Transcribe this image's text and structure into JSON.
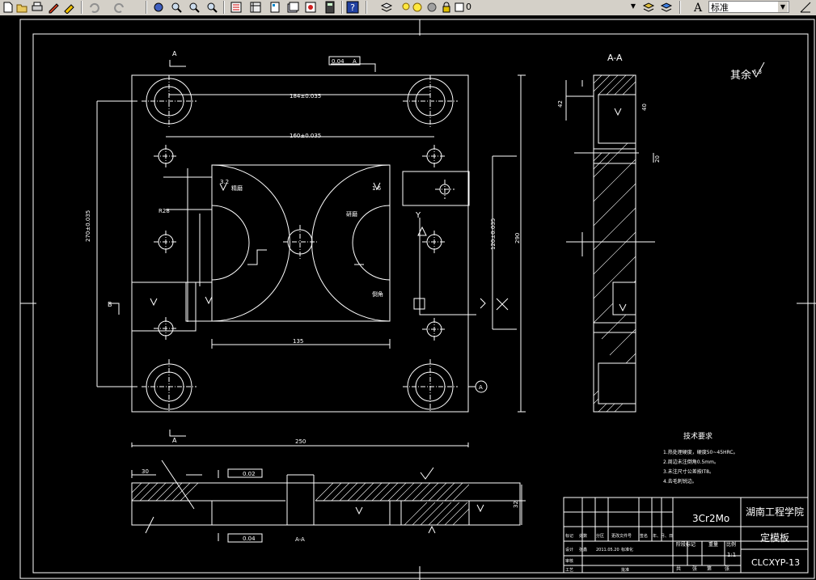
{
  "toolbar": {
    "icons": [
      "new-icon",
      "open-icon",
      "draw-icon",
      "match-properties-icon",
      "undo-icon",
      "redo-icon",
      "pan-icon",
      "zoom-realtime-icon",
      "zoom-window-icon",
      "zoom-previous-icon",
      "properties-icon",
      "design-center-icon",
      "tool-palettes-icon",
      "sheet-set-icon",
      "markup-icon",
      "calculator-icon",
      "help-icon",
      "layer-manager-icon",
      "layer-on-icon",
      "layer-freeze-icon",
      "layer-color-icon",
      "layer-lock-icon"
    ],
    "layer_value": "0",
    "textstyle_value": "标准"
  },
  "drawing": {
    "section_title": "A-A",
    "roughness_note": "其余",
    "roughness_value": "6.3",
    "tech_title": "技术要求",
    "tech_notes": [
      "1.热处理硬度，硬度50~45HRC。",
      "2.周边未注倒角0.5mm。",
      "3.未注尺寸公差按IT8。",
      "4.去毛刺锐边。"
    ],
    "material": "3Cr2Mo",
    "school": "湖南工程学院",
    "part_name": "定模板",
    "drawing_no": "CLCXYP-13",
    "scale": "1:1",
    "scale_header": "比例",
    "tb_headers": [
      "阶段标记",
      "重量"
    ],
    "tb_footer": [
      "共",
      "张",
      "第",
      "张"
    ],
    "tb_left": [
      "标记",
      "处数",
      "分区",
      "更改文件号",
      "签名",
      "年、月、日"
    ],
    "tb_left2": [
      "设计",
      "张鑫",
      "2011.05.20",
      "标准化"
    ],
    "tb_left3": [
      "审核"
    ],
    "tb_left4": [
      "工艺",
      "批准"
    ],
    "dims": {
      "top1": "184±0.035",
      "top2": "160±0.035",
      "left_v": "270±0.035",
      "right_v": "120±0.035",
      "overall_v": "290",
      "bottom": "250",
      "inner_w": "135",
      "radius": "R28",
      "r_label1": "1.6",
      "r_label2": "3.2",
      "side_t": "42",
      "side_h1": "40",
      "side_h2": "20",
      "bot_30": "30",
      "bot_h": "32"
    },
    "markers": {
      "a_label": "A",
      "b_label": "B",
      "y_label": "Y",
      "x_label": "X",
      "datum": "A"
    },
    "gdt": [
      "0.04",
      "A",
      "0.02",
      "0.04"
    ],
    "misc": [
      "精磨",
      "研磨",
      "倒角",
      "A-A"
    ]
  }
}
